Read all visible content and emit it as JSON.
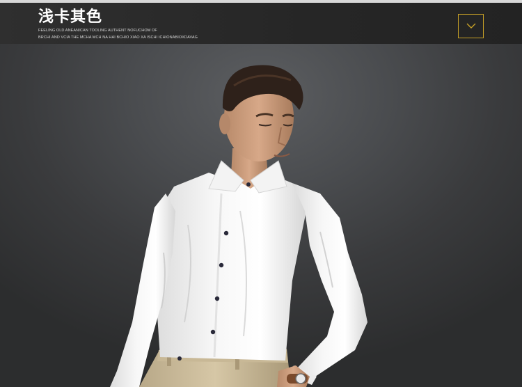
{
  "header": {
    "title": "浅卡其色",
    "subtitle_line1": "FEELING OLD ANEANICAN TOOLING AUTHENT NOFUCHOM OF",
    "subtitle_line2": "BRCHI AND VCIA THE MCHA MCH NA HAI BCHIO XIAO XA ISCHI ICHIONABIOXDAVAG"
  },
  "dropdown": {
    "icon": "chevron-down-icon",
    "border_color": "#c9a227"
  },
  "scene": {
    "image": "model-in-white-shirt"
  }
}
